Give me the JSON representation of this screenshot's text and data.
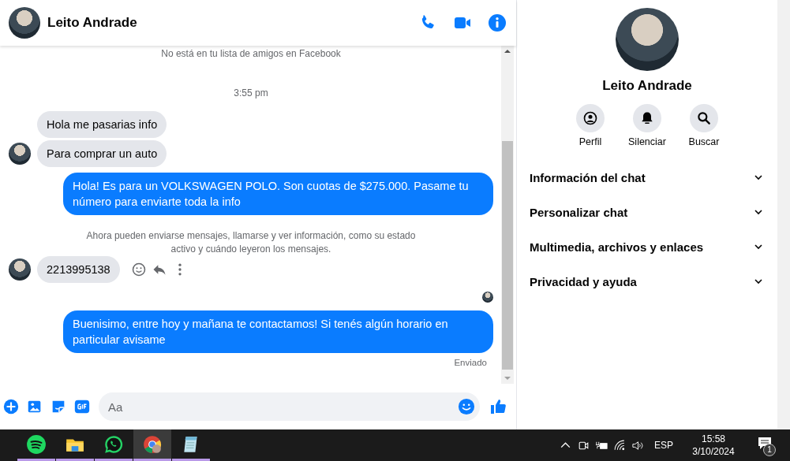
{
  "chat_header": {
    "name": "Leito Andrade"
  },
  "messages": [
    {
      "kind": "notice",
      "text": "No está en tu lista de amigos en Facebook"
    },
    {
      "kind": "time",
      "text": "3:55 pm"
    },
    {
      "kind": "incoming",
      "text": "Hola me pasarias info",
      "avatar": false
    },
    {
      "kind": "incoming",
      "text": "Para comprar un auto",
      "avatar": true
    },
    {
      "kind": "outgoing",
      "text": "Hola! Es para un VOLKSWAGEN POLO. Son cuotas de $275.000. Pasame tu número para enviarte toda la info"
    },
    {
      "kind": "notice",
      "text": "Ahora pueden enviarse mensajes, llamarse y ver información, como su estado activo y cuándo leyeron los mensajes."
    },
    {
      "kind": "incoming",
      "text": "2213995138",
      "avatar": true,
      "actions": true
    },
    {
      "kind": "seen"
    },
    {
      "kind": "outgoing",
      "text": "Buenisimo, entre hoy y mañana te contactamos! Si tenés algún horario en particular avisame"
    },
    {
      "kind": "status",
      "text": "Enviado"
    }
  ],
  "composer": {
    "placeholder": "Aa"
  },
  "profile": {
    "name": "Leito Andrade",
    "actions": [
      {
        "kind": "profile",
        "label": "Perfil"
      },
      {
        "kind": "mute",
        "label": "Silenciar"
      },
      {
        "kind": "search",
        "label": "Buscar"
      }
    ],
    "sections": [
      {
        "label": "Información del chat",
        "expanded": false
      },
      {
        "label": "Personalizar chat",
        "expanded": false
      },
      {
        "label": "Multimedia, archivos y enlaces",
        "expanded": false
      },
      {
        "label": "Privacidad y ayuda",
        "expanded": false
      }
    ]
  },
  "taskbar": {
    "apps": [
      {
        "kind": "spotify",
        "selected": false
      },
      {
        "kind": "folder",
        "selected": false
      },
      {
        "kind": "whatsapp",
        "selected": false
      },
      {
        "kind": "browser",
        "selected": true
      },
      {
        "kind": "notepad",
        "selected": false
      }
    ],
    "language": "ESP",
    "time": "15:58",
    "date": "3/10/2024",
    "notifications": "1"
  }
}
